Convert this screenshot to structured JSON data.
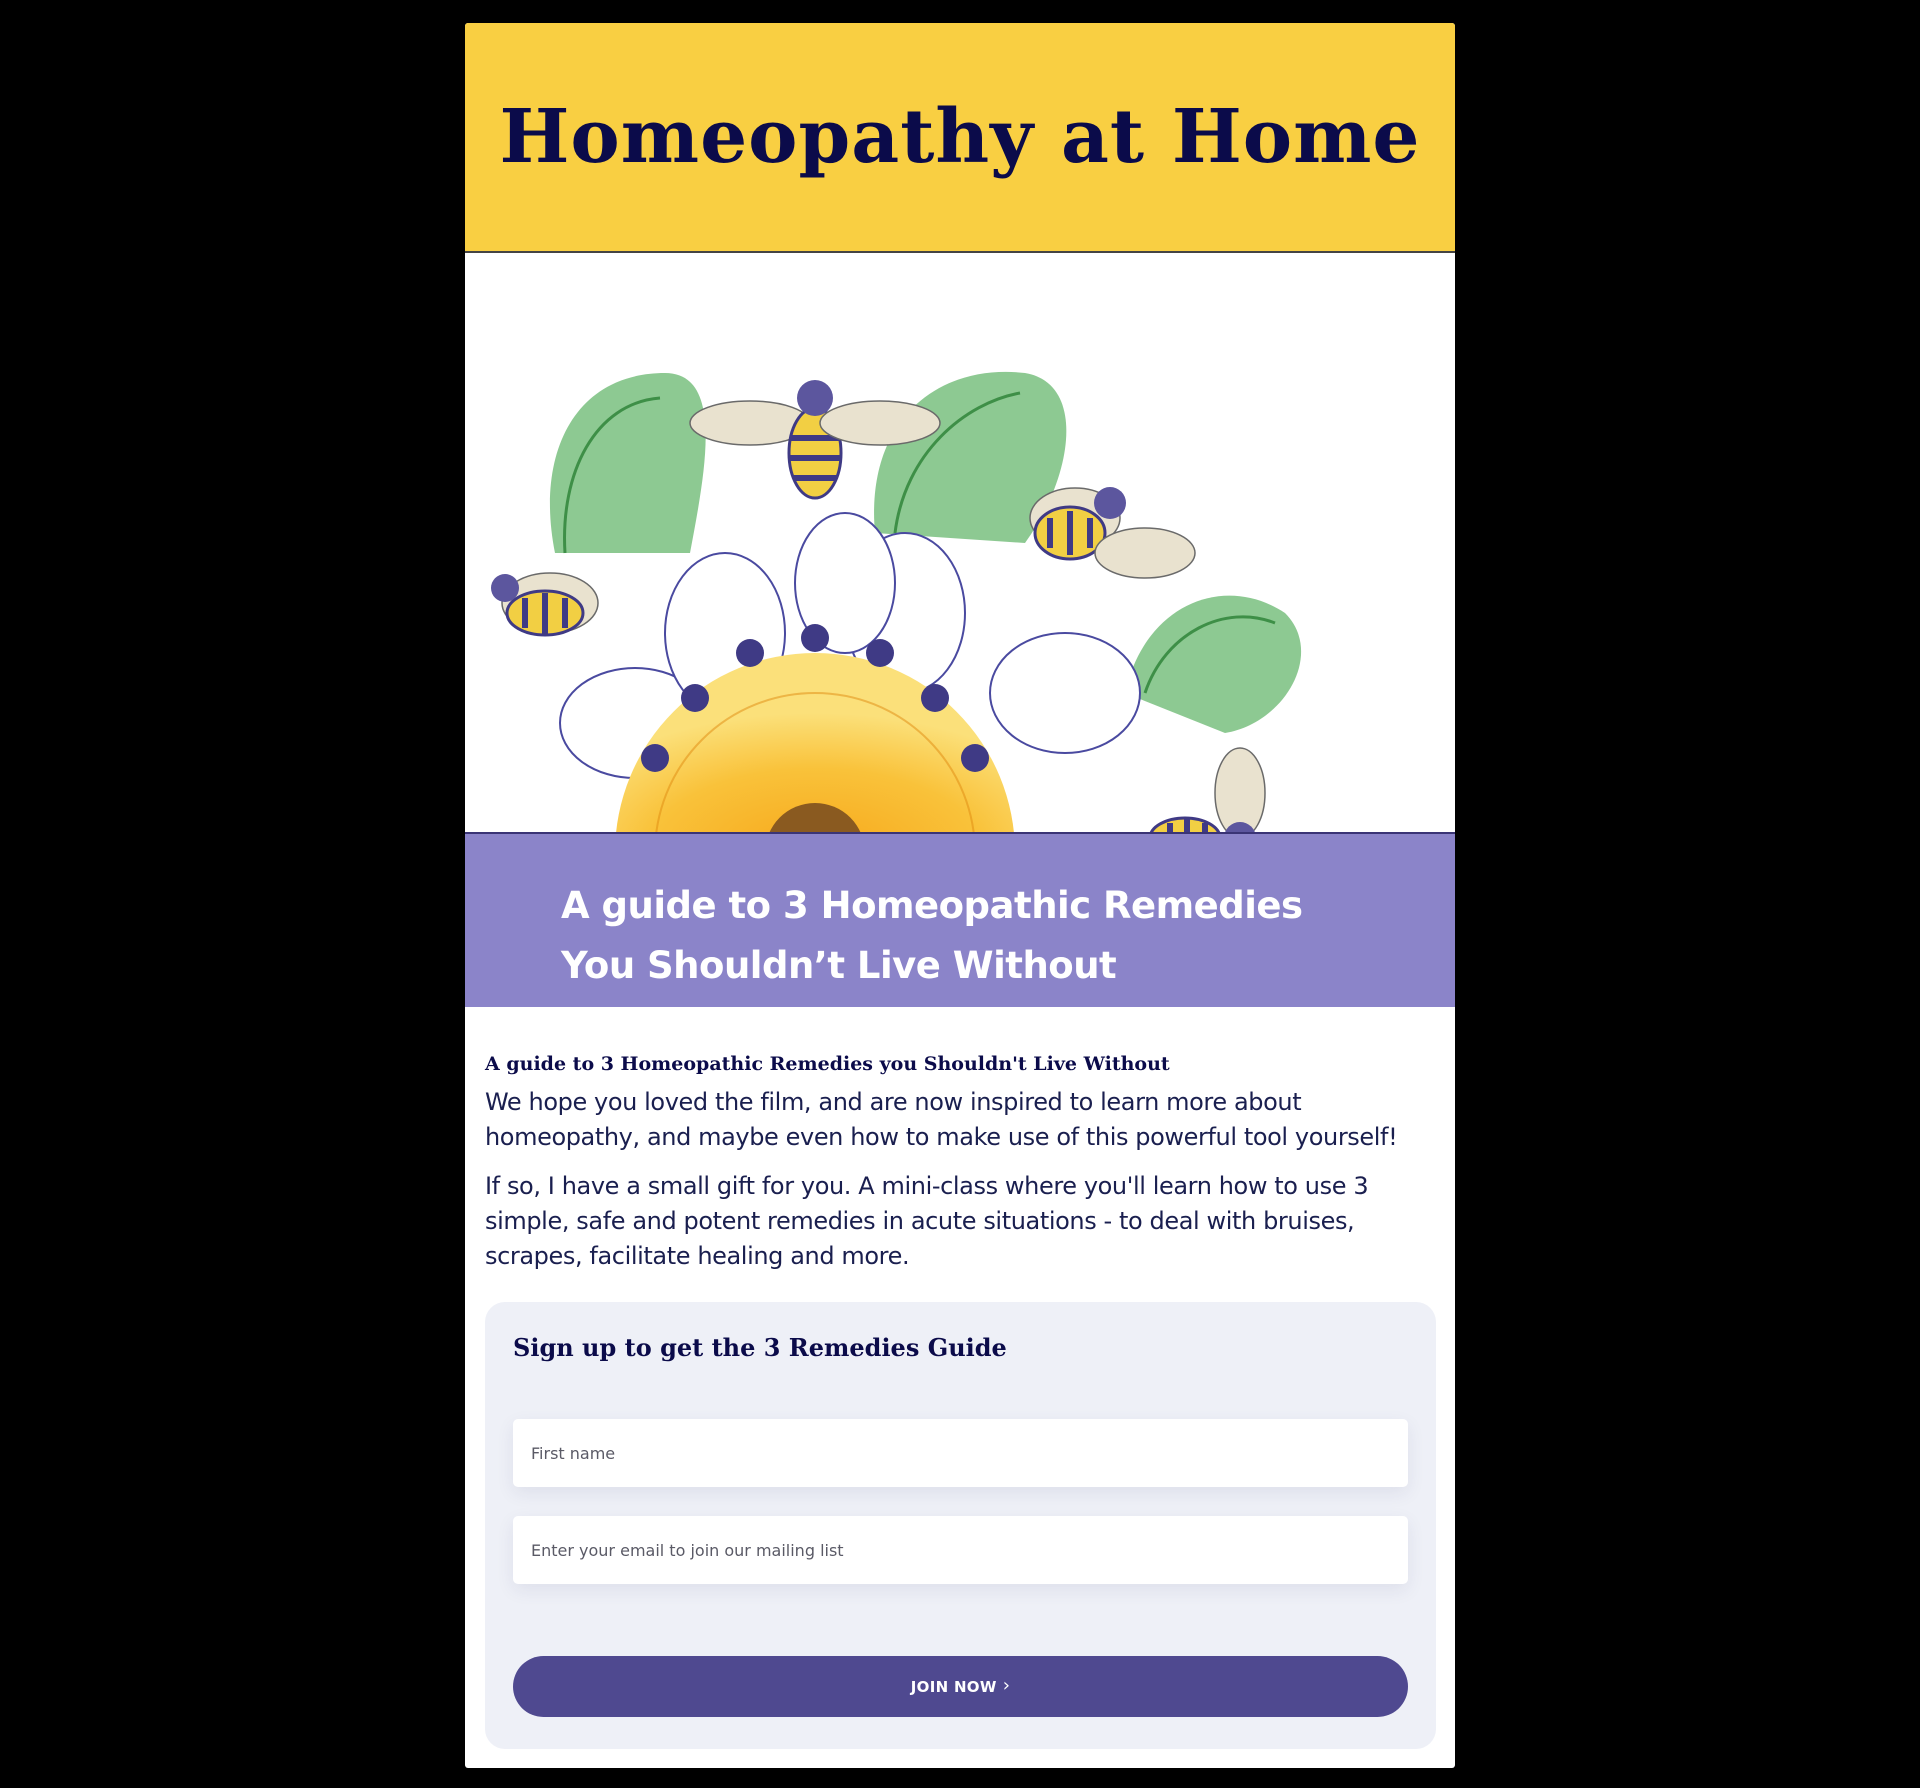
{
  "header": {
    "title": "Homeopathy at Home",
    "background": "#f9cf42",
    "title_color": "#0b0b4a"
  },
  "hero": {
    "band_line_1": "A guide to 3 Homeopathic Remedies",
    "band_line_2": "You Shouldn’t Live Without",
    "band_color": "#8b84c9"
  },
  "content": {
    "heading": "A guide to 3 Homeopathic Remedies you Shouldn't Live Without",
    "paragraph_1": "We hope you loved the film, and are now inspired to learn more about homeopathy, and maybe even how to make use of this powerful tool yourself!",
    "paragraph_2": "If so, I have a small gift for you. A mini-class where you'll learn how to use 3 simple, safe and potent remedies in acute situations - to deal with bruises, scrapes, facilitate healing and more."
  },
  "signup": {
    "title": "Sign up to get the 3 Remedies Guide",
    "first_name_placeholder": "First name",
    "email_placeholder": "Enter your email to join our mailing list",
    "button_label": "JOIN NOW",
    "button_icon": "chevron-right-icon",
    "button_color": "#4f4990"
  }
}
